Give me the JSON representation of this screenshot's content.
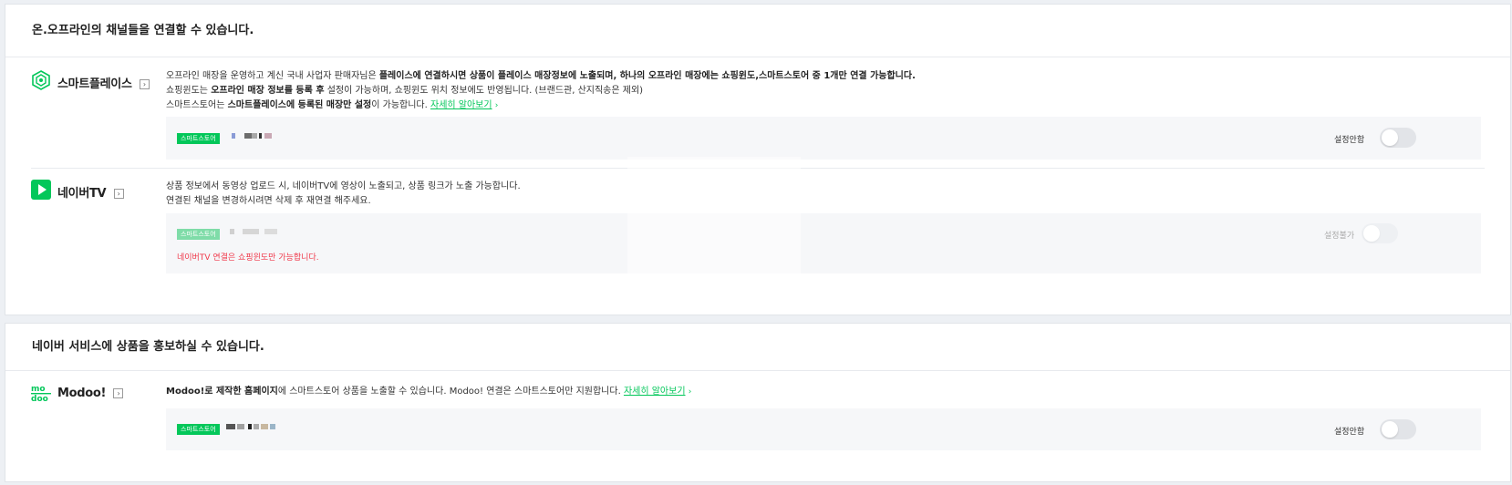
{
  "channels_section": {
    "title": "온.오프라인의 채널들을 연결할 수 있습니다.",
    "smartplace": {
      "name": "스마트플레이스",
      "ext_icon": "external-link-icon",
      "desc_line1_a": "오프라인 매장을 운영하고 계신 국내 사업자 판매자님은 ",
      "desc_line1_b": "플레이스에 연결하시면 상품이 플레이스 매장정보에 노출되며, 하나의 오프라인 매장에는 쇼핑윈도,스마트스토어 중 1개만 연결 가능합니다.",
      "desc_line2_a": "쇼핑윈도는 ",
      "desc_line2_b": "오프라인 매장 정보를 등록 후",
      "desc_line2_c": " 설정이 가능하며, 쇼핑윈도 위치 정보에도 반영됩니다. (브랜드관, 산지직송은 제외)",
      "desc_line3_a": "스마트스토어는 ",
      "desc_line3_b": "스마트플레이스에 등록된 매장만 설정",
      "desc_line3_c": "이 가능합니다. ",
      "learn_more": "자세히 알아보기",
      "chevron": "›",
      "store_badge": "스마트스토어",
      "toggle_label": "설정안함"
    },
    "navertv": {
      "name": "네이버TV",
      "ext_icon": "external-link-icon",
      "desc_line1": "상품 정보에서 동영상 업로드 시, 네이버TV에 영상이 노출되고, 상품 링크가 노출 가능합니다.",
      "desc_line2": "연결된 채널을 변경하시려면 삭제 후 재연결 해주세요.",
      "store_badge": "스마트스토어",
      "error": "네이버TV 연결은 쇼핑윈도만 가능합니다.",
      "toggle_label": "설정불가"
    }
  },
  "promo_section": {
    "title": "네이버 서비스에 상품을 홍보하실 수 있습니다.",
    "modoo": {
      "name": "Modoo!",
      "ext_icon": "external-link-icon",
      "desc_a": "Modoo!로 제작한 홈페이지",
      "desc_b": "에 스마트스토어 상품을 노출할 수 있습니다. Modoo! 연결은 스마트스토어만 지원합니다. ",
      "learn_more": "자세히 알아보기",
      "chevron": "›",
      "store_badge": "스마트스토어",
      "toggle_label": "설정안함"
    }
  },
  "colors": {
    "accent": "#03c75a",
    "error": "#f0384a",
    "page_bg": "#edf0f4",
    "box_bg": "#f6f7f9"
  }
}
